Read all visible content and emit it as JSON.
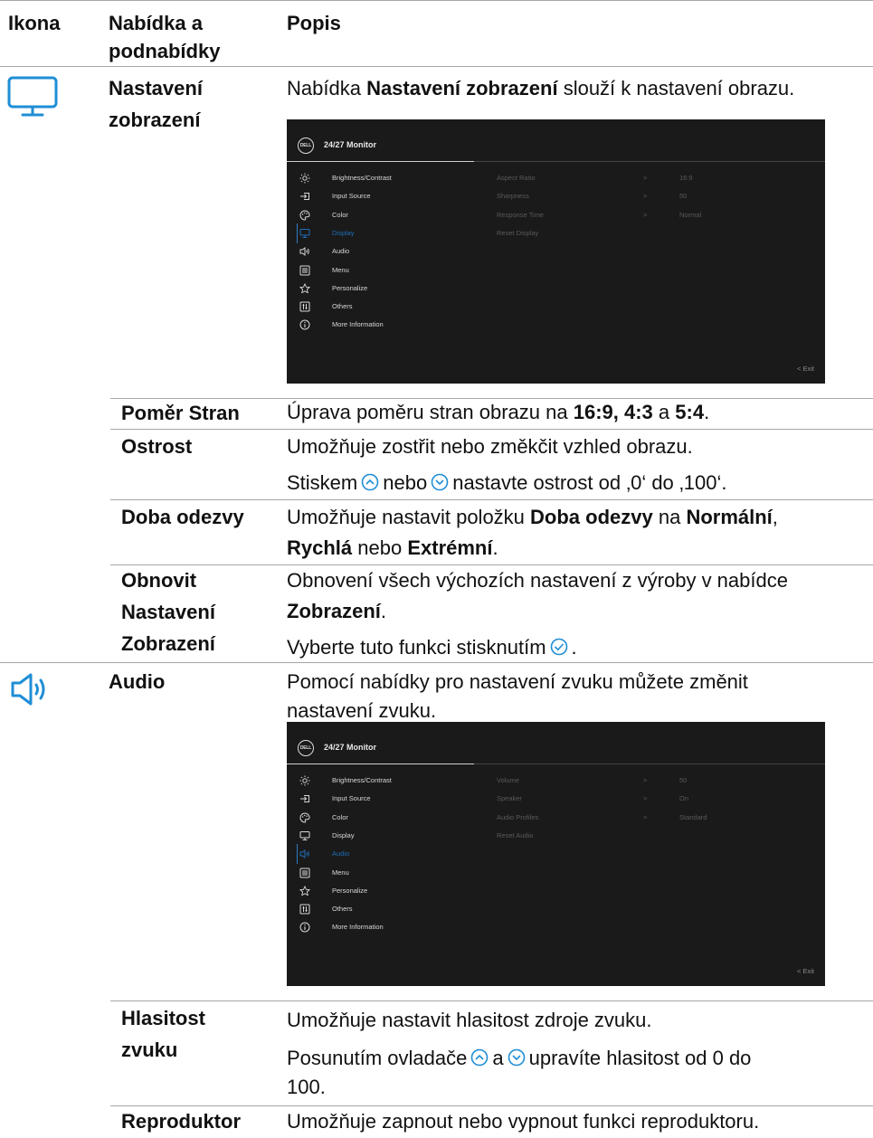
{
  "headers": {
    "icon": "Ikona",
    "menu_line1": "Nabídka a",
    "menu_line2": "podnabídky",
    "description": "Popis"
  },
  "display_section": {
    "icon": "monitor-icon",
    "name_line1": "Nastavení",
    "name_line2": "zobrazení",
    "intro_before": "Nabídka ",
    "intro_bold": "Nastavení zobrazení",
    "intro_after": " slouží k nastavení obrazu.",
    "osd": {
      "logo": "DELL",
      "title": "24/27 Monitor",
      "menu_items": [
        "Brightness/Contrast",
        "Input Source",
        "Color",
        "Display",
        "Audio",
        "Menu",
        "Personalize",
        "Others",
        "More Information"
      ],
      "active_item": "Display",
      "options": [
        {
          "label": "Aspect Ratio",
          "arrow": ">",
          "value": "16:9"
        },
        {
          "label": "Sharpness",
          "arrow": ">",
          "value": "50"
        },
        {
          "label": "Response Time",
          "arrow": ">",
          "value": "Normal"
        },
        {
          "label": "Reset Display",
          "arrow": "",
          "value": ""
        }
      ],
      "exit": "< Exit"
    },
    "rows": {
      "aspect": {
        "name": "Poměr Stran",
        "text_before": "Úprava poměru stran obrazu na ",
        "bold1": "16:9, 4:3",
        "text_mid": " a ",
        "bold2": "5:4",
        "text_after": "."
      },
      "sharpness": {
        "name": "Ostrost",
        "line1": "Umožňuje zostřit nebo změkčit vzhled obrazu.",
        "line2_before": "Stiskem",
        "line2_mid": "nebo",
        "line2_after": "nastavte ostrost od ‚0‘ do ‚100‘."
      },
      "response": {
        "name": "Doba odezvy",
        "line1_before": "Umožňuje nastavit položku ",
        "line1_bold1": "Doba odezvy",
        "line1_mid": " na ",
        "line1_bold2": "Normální",
        "line1_after": ",",
        "line2_bold1": "Rychlá",
        "line2_mid": " nebo ",
        "line2_bold2": "Extrémní",
        "line2_after": "."
      },
      "reset": {
        "name_line1": "Obnovit",
        "name_line2": "Nastavení",
        "name_line3": "Zobrazení",
        "line1": "Obnovení všech výchozích nastavení z výroby v nabídce",
        "line2_bold": "Zobrazení",
        "line2_after": ".",
        "line3_before": "Vyberte tuto funkci stisknutím",
        "line3_after": "."
      }
    }
  },
  "audio_section": {
    "icon": "speaker-icon",
    "name": "Audio",
    "intro_line1": "Pomocí nabídky pro nastavení zvuku můžete změnit",
    "intro_line2": "nastavení zvuku.",
    "osd": {
      "logo": "DELL",
      "title": "24/27 Monitor",
      "menu_items": [
        "Brightness/Contrast",
        "Input Source",
        "Color",
        "Display",
        "Audio",
        "Menu",
        "Personalize",
        "Others",
        "More Information"
      ],
      "active_item": "Audio",
      "options": [
        {
          "label": "Volume",
          "arrow": ">",
          "value": "50"
        },
        {
          "label": "Speaker",
          "arrow": ">",
          "value": "On"
        },
        {
          "label": "Audio Profiles",
          "arrow": ">",
          "value": "Standard"
        },
        {
          "label": "Reset Audio",
          "arrow": "",
          "value": ""
        }
      ],
      "exit": "< Exit"
    },
    "rows": {
      "volume": {
        "name_line1": "Hlasitost",
        "name_line2": "zvuku",
        "line1": "Umožňuje nastavit hlasitost zdroje zvuku.",
        "line2_before": "Posunutím ovladače",
        "line2_mid": "a",
        "line2_after": "upravíte hlasitost od 0 do",
        "line3": "100."
      },
      "speaker": {
        "name": "Reproduktor",
        "line1": "Umožňuje zapnout nebo vypnout funkci reproduktoru."
      }
    }
  }
}
